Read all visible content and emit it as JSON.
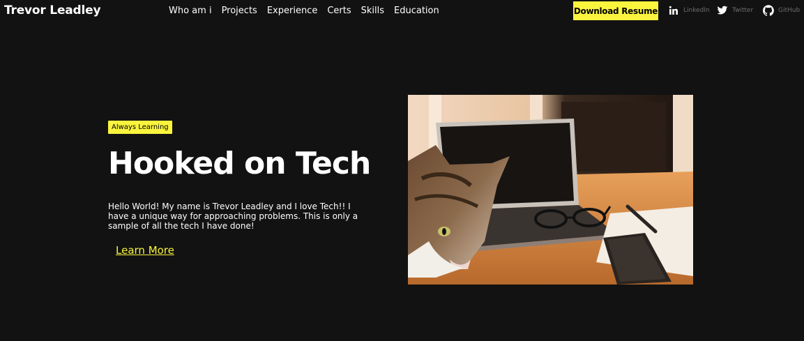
{
  "nav": {
    "brand": "Trevor Leadley",
    "items": [
      "Who am i",
      "Projects",
      "Experience",
      "Certs",
      "Skills",
      "Education"
    ],
    "download_label": "Download Resume",
    "social": [
      {
        "label": "LinkedIn",
        "icon": "linkedin-icon"
      },
      {
        "label": "Twitter",
        "icon": "twitter-icon"
      },
      {
        "label": "GitHub",
        "icon": "github-icon"
      }
    ]
  },
  "hero": {
    "badge": "Always Learning",
    "title": "Hooked on Tech",
    "description": "Hello World! My name is Trevor Leadley and I love Tech!! I have a unique way for approaching problems. This is only a sample of all the tech I have done!",
    "cta": "Learn More",
    "image": "photo of a cat beside a laptop, glasses and phone on a wooden desk"
  },
  "colors": {
    "background": "#121212",
    "accent": "#fbf43e",
    "muted": "#6e6e6e"
  }
}
